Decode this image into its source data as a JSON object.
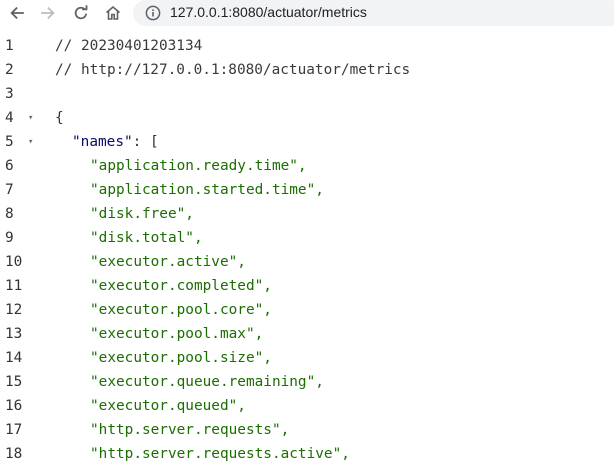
{
  "browser": {
    "url": "127.0.0.1:8080/actuator/metrics",
    "back_icon": "arrow-left-icon",
    "forward_icon": "arrow-right-icon",
    "reload_icon": "reload-icon",
    "home_icon": "home-icon",
    "info_icon": "info-circle-icon"
  },
  "viewer": {
    "comment_timestamp": "// 20230401203134",
    "comment_url": "// http://127.0.0.1:8080/actuator/metrics",
    "open_brace": "{",
    "names_key": "\"names\"",
    "names_sep": ": [",
    "fold_marker": "▾",
    "line_numbers": [
      "1",
      "2",
      "3",
      "4",
      "5",
      "6",
      "7",
      "8",
      "9",
      "10",
      "11",
      "12",
      "13",
      "14",
      "15",
      "16",
      "17",
      "18"
    ],
    "names": [
      "\"application.ready.time\",",
      "\"application.started.time\",",
      "\"disk.free\",",
      "\"disk.total\",",
      "\"executor.active\",",
      "\"executor.completed\",",
      "\"executor.pool.core\",",
      "\"executor.pool.max\",",
      "\"executor.pool.size\",",
      "\"executor.queue.remaining\",",
      "\"executor.queued\",",
      "\"http.server.requests\",",
      "\"http.server.requests.active\","
    ]
  },
  "colors": {
    "key": "#0a0a6e",
    "string": "#1a6f00",
    "text": "#333333",
    "omnibox_bg": "#f1f3f4"
  }
}
